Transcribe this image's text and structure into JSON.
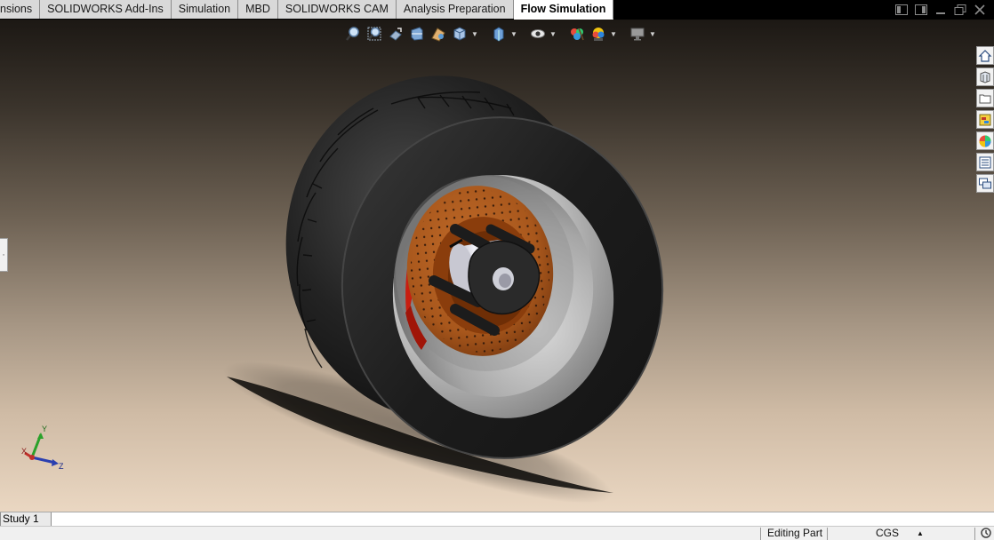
{
  "tabs": [
    {
      "label": "nsions"
    },
    {
      "label": "SOLIDWORKS Add-Ins"
    },
    {
      "label": "Simulation"
    },
    {
      "label": "MBD"
    },
    {
      "label": "SOLIDWORKS CAM"
    },
    {
      "label": "Analysis Preparation"
    },
    {
      "label": "Flow Simulation",
      "active": true
    }
  ],
  "heads_up_toolbar": [
    "zoom-to-fit-icon",
    "zoom-to-area-icon",
    "previous-view-icon",
    "section-view-icon",
    "dynamic-annotation-icon",
    "view-orientation-icon",
    "display-style-icon",
    "hide-show-items-icon",
    "edit-appearance-icon",
    "apply-scene-icon",
    "view-settings-icon"
  ],
  "task_pane": [
    "home-icon",
    "design-library-icon",
    "file-explorer-icon",
    "view-palette-icon",
    "appearances-icon",
    "custom-properties-icon",
    "forum-icon"
  ],
  "triad": {
    "x": "X",
    "y": "Y",
    "z": "Z"
  },
  "bottom_tabs": {
    "study": "Study 1"
  },
  "status": {
    "mode": "Editing Part",
    "units": "CGS",
    "arrow": "▲"
  },
  "colors": {
    "rotor": "#a8571c",
    "caliper": "#c81e10",
    "tire": "#1e1e1e",
    "rim": "#c4c4c4",
    "hub": "#2a2a2a"
  }
}
